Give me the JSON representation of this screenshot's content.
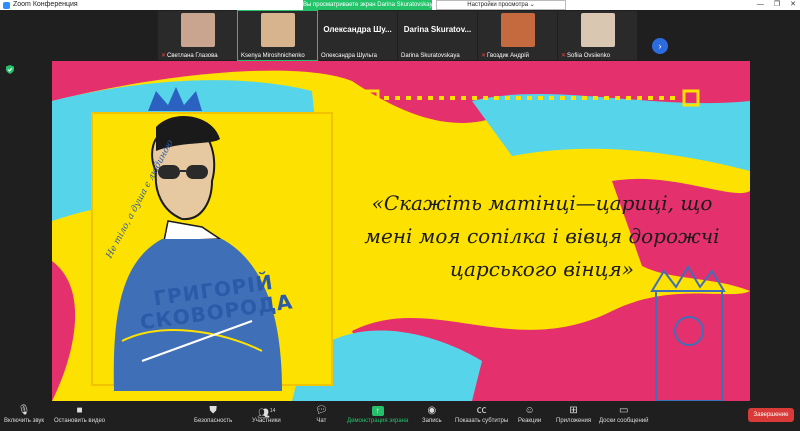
{
  "window": {
    "title": "Zoom Конференция",
    "minimize": "—",
    "maximize": "❐",
    "close": "✕"
  },
  "share_banner": "Вы просматриваете экран Darina Skuratovskaya",
  "view_options": "Настройки просмотра ⌄",
  "participants": [
    {
      "name": "Светлана Глазова",
      "muted": true,
      "video": true,
      "color": "#c9a58f"
    },
    {
      "name": "Ksenya Miroshnichenko",
      "muted": false,
      "video": true,
      "color": "#d8b48e"
    },
    {
      "name": "Олександра Шульга",
      "muted": false,
      "video": false,
      "display": "Олександра Шу..."
    },
    {
      "name": "Darina Skuratovskaya",
      "muted": false,
      "video": false,
      "display": "Darina Skuratov..."
    },
    {
      "name": "Гвоздик Андрій",
      "muted": true,
      "video": true,
      "color": "#c56a3e"
    },
    {
      "name": "Sofiia Ovsiienko",
      "muted": true,
      "video": true,
      "color": "#d9c7b1"
    }
  ],
  "next_arrow": "›",
  "slide": {
    "quote": "«Скажіть матінці—цариці, що мені моя сопілка і вівця дорожчі царського вінця»",
    "side_text": "Не тіло, а душа є людиною",
    "name_text": "ГРИГОРІЙ СКОВОРОДА",
    "colors": {
      "yellow": "#fde100",
      "pink": "#e5306e",
      "cyan": "#56d5ea",
      "blue": "#3f6fb6"
    }
  },
  "toolbar": {
    "audio": {
      "label": "Включить звук",
      "icon": "mic-off-icon"
    },
    "video": {
      "label": "Остановить видео",
      "icon": "camera-icon"
    },
    "security": {
      "label": "Безопасность",
      "icon": "shield-icon"
    },
    "participants": {
      "label": "Участники",
      "count": "14",
      "icon": "people-icon"
    },
    "chat": {
      "label": "Чат",
      "icon": "chat-icon"
    },
    "share": {
      "label": "Демонстрация экрана",
      "icon": "share-screen-icon"
    },
    "record": {
      "label": "Запись",
      "icon": "record-icon"
    },
    "captions": {
      "label": "Показать субтитры",
      "icon": "cc-icon"
    },
    "reactions": {
      "label": "Реакции",
      "icon": "reaction-icon"
    },
    "apps": {
      "label": "Приложения",
      "icon": "apps-icon"
    },
    "whiteboard": {
      "label": "Доски сообщений",
      "icon": "whiteboard-icon"
    },
    "end": {
      "label": "Завершение"
    }
  }
}
